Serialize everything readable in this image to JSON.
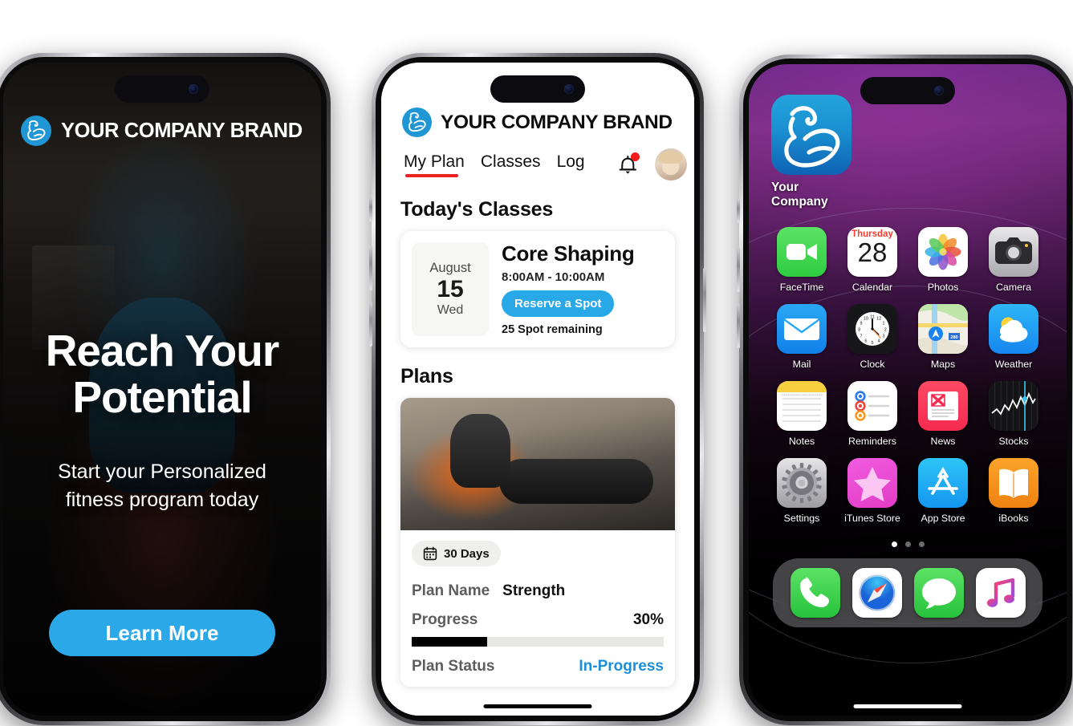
{
  "brand": {
    "name": "YOUR COMPANY BRAND",
    "logo_icon": "flexed-biceps-icon",
    "accent": "#2aa8e8"
  },
  "phone1": {
    "hero": {
      "title_line1": "Reach Your",
      "title_line2": "Potential",
      "subtitle_line1": "Start your Personalized",
      "subtitle_line2": "fitness program today",
      "cta_label": "Learn More"
    }
  },
  "phone2": {
    "nav": {
      "items": [
        "My Plan",
        "Classes",
        "Log"
      ],
      "active": "My Plan",
      "bell_icon": "notification-bell-icon",
      "has_badge": true,
      "avatar_icon": "user-avatar"
    },
    "classes_section": {
      "title": "Today's Classes",
      "card": {
        "month": "August",
        "day": "15",
        "weekday": "Wed",
        "name": "Core Shaping",
        "time": "8:00AM - 10:00AM",
        "reserve_label": "Reserve a Spot",
        "spots": "25 Spot remaining"
      }
    },
    "plans_section": {
      "title": "Plans",
      "duration_chip": "30 Days",
      "duration_icon": "calendar-icon",
      "rows": [
        {
          "label": "Plan Name",
          "value": "Strength"
        },
        {
          "label": "Progress",
          "value": "30%"
        },
        {
          "label": "Plan Status",
          "value": "In-Progress"
        }
      ],
      "progress_percent": 30,
      "status_color": "#1b8fd6"
    }
  },
  "phone3": {
    "featured_app": {
      "label": "Your Company",
      "icon": "flexed-biceps-icon"
    },
    "grid": [
      {
        "label": "FaceTime",
        "icon": "facetime-icon"
      },
      {
        "label": "Calendar",
        "icon": "calendar-icon",
        "weekday": "Thursday",
        "day": "28"
      },
      {
        "label": "Photos",
        "icon": "photos-icon"
      },
      {
        "label": "Camera",
        "icon": "camera-icon"
      },
      {
        "label": "Mail",
        "icon": "mail-icon"
      },
      {
        "label": "Clock",
        "icon": "clock-icon"
      },
      {
        "label": "Maps",
        "icon": "maps-icon",
        "badge": "280"
      },
      {
        "label": "Weather",
        "icon": "weather-icon"
      },
      {
        "label": "Notes",
        "icon": "notes-icon"
      },
      {
        "label": "Reminders",
        "icon": "reminders-icon"
      },
      {
        "label": "News",
        "icon": "news-icon"
      },
      {
        "label": "Stocks",
        "icon": "stocks-icon"
      },
      {
        "label": "Settings",
        "icon": "settings-gear-icon"
      },
      {
        "label": "iTunes Store",
        "icon": "itunes-store-icon"
      },
      {
        "label": "App Store",
        "icon": "app-store-icon"
      },
      {
        "label": "iBooks",
        "icon": "ibooks-icon"
      }
    ],
    "page_dots": {
      "count": 3,
      "active_index": 0
    },
    "dock": [
      {
        "label": "Phone",
        "icon": "phone-icon"
      },
      {
        "label": "Safari",
        "icon": "safari-compass-icon"
      },
      {
        "label": "Messages",
        "icon": "messages-bubble-icon"
      },
      {
        "label": "Music",
        "icon": "music-note-icon"
      }
    ]
  }
}
